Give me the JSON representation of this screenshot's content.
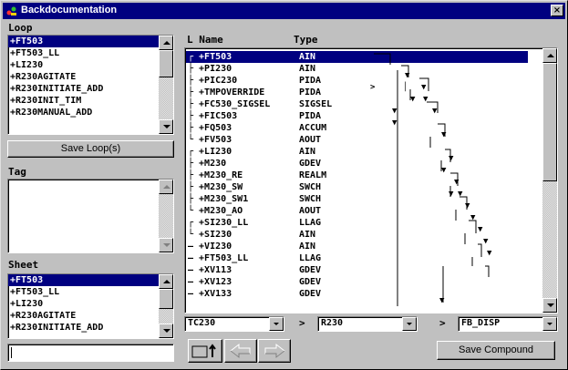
{
  "window": {
    "title": "Backdocumentation",
    "close_label": "×"
  },
  "loop": {
    "label": "Loop",
    "items": [
      "+FT503",
      "+FT503_LL",
      "+LI230",
      "+R230AGITATE",
      "+R230INITIATE_ADD",
      "+R230INIT_TIM",
      "+R230MANUAL_ADD"
    ],
    "selected_index": 0,
    "save_button": "Save Loop(s)"
  },
  "tag": {
    "label": "Tag",
    "items": []
  },
  "sheet": {
    "label": "Sheet",
    "items": [
      "+FT503",
      "+FT503_LL",
      "+LI230",
      "+R230AGITATE",
      "+R230INITIATE_ADD"
    ],
    "selected_index": 0,
    "input_value": ""
  },
  "grid": {
    "col_name": "L Name",
    "col_type": "Type",
    "rows": [
      {
        "tree": "┌",
        "name": "+FT503",
        "type": "AIN"
      },
      {
        "tree": "├",
        "name": "+PI230",
        "type": "AIN"
      },
      {
        "tree": "├",
        "name": "+PIC230",
        "type": "PIDA"
      },
      {
        "tree": "├",
        "name": "+TMPOVERRIDE",
        "type": "PIDA"
      },
      {
        "tree": "├",
        "name": "+FC530_SIGSEL",
        "type": "SIGSEL"
      },
      {
        "tree": "├",
        "name": "+FIC503",
        "type": "PIDA"
      },
      {
        "tree": "├",
        "name": "+FQ503",
        "type": "ACCUM"
      },
      {
        "tree": "└",
        "name": "+FV503",
        "type": "AOUT"
      },
      {
        "tree": "┌",
        "name": "+LI230",
        "type": "AIN"
      },
      {
        "tree": "├",
        "name": "+M230",
        "type": "GDEV"
      },
      {
        "tree": "├",
        "name": "+M230_RE",
        "type": "REALM"
      },
      {
        "tree": "├",
        "name": "+M230_SW",
        "type": "SWCH"
      },
      {
        "tree": "├",
        "name": "+M230_SW1",
        "type": "SWCH"
      },
      {
        "tree": "└",
        "name": "+M230_AO",
        "type": "AOUT"
      },
      {
        "tree": "┌",
        "name": "+SI230_LL",
        "type": "LLAG"
      },
      {
        "tree": "└",
        "name": "+SI230",
        "type": "AIN"
      },
      {
        "tree": "—",
        "name": "+VI230",
        "type": "AIN"
      },
      {
        "tree": "—",
        "name": "+FT503_LL",
        "type": "LLAG"
      },
      {
        "tree": "—",
        "name": "+XV113",
        "type": "GDEV"
      },
      {
        "tree": "—",
        "name": "+XV123",
        "type": "GDEV"
      },
      {
        "tree": "—",
        "name": "+XV133",
        "type": "GDEV"
      }
    ]
  },
  "bottom": {
    "combo1": "TC230",
    "combo2": "R230",
    "combo3": "FB_DISP",
    "sep": ">",
    "save_compound": "Save Compound",
    "icon_back": "left-arrow-icon",
    "icon_forward": "right-arrow-icon",
    "icon_export": "box-arrow-icon"
  }
}
